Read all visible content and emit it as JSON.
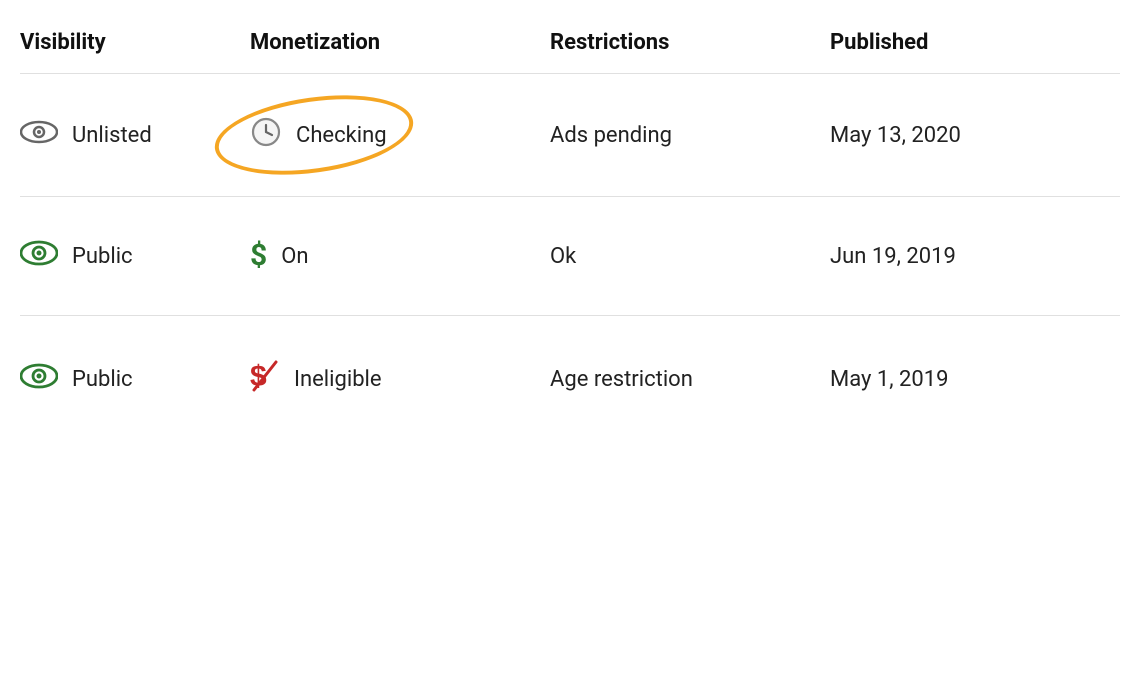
{
  "header": {
    "col1": "Visibility",
    "col2": "Monetization",
    "col3": "Restrictions",
    "col4": "Published"
  },
  "rows": [
    {
      "id": "row1",
      "visibility": {
        "type": "unlisted",
        "label": "Unlisted"
      },
      "monetization": {
        "type": "checking",
        "icon": "clock",
        "label": "Checking",
        "highlighted": true
      },
      "restrictions": "Ads pending",
      "published": "May 13, 2020"
    },
    {
      "id": "row2",
      "visibility": {
        "type": "public",
        "label": "Public"
      },
      "monetization": {
        "type": "on",
        "icon": "dollar-green",
        "label": "On",
        "highlighted": false
      },
      "restrictions": "Ok",
      "published": "Jun 19, 2019"
    },
    {
      "id": "row3",
      "visibility": {
        "type": "public",
        "label": "Public"
      },
      "monetization": {
        "type": "ineligible",
        "icon": "dollar-red",
        "label": "Ineligible",
        "highlighted": false
      },
      "restrictions": "Age restriction",
      "published": "May 1, 2019"
    }
  ],
  "colors": {
    "green": "#2e7d32",
    "grey": "#666",
    "red": "#c62828",
    "highlight": "#f5a623"
  }
}
